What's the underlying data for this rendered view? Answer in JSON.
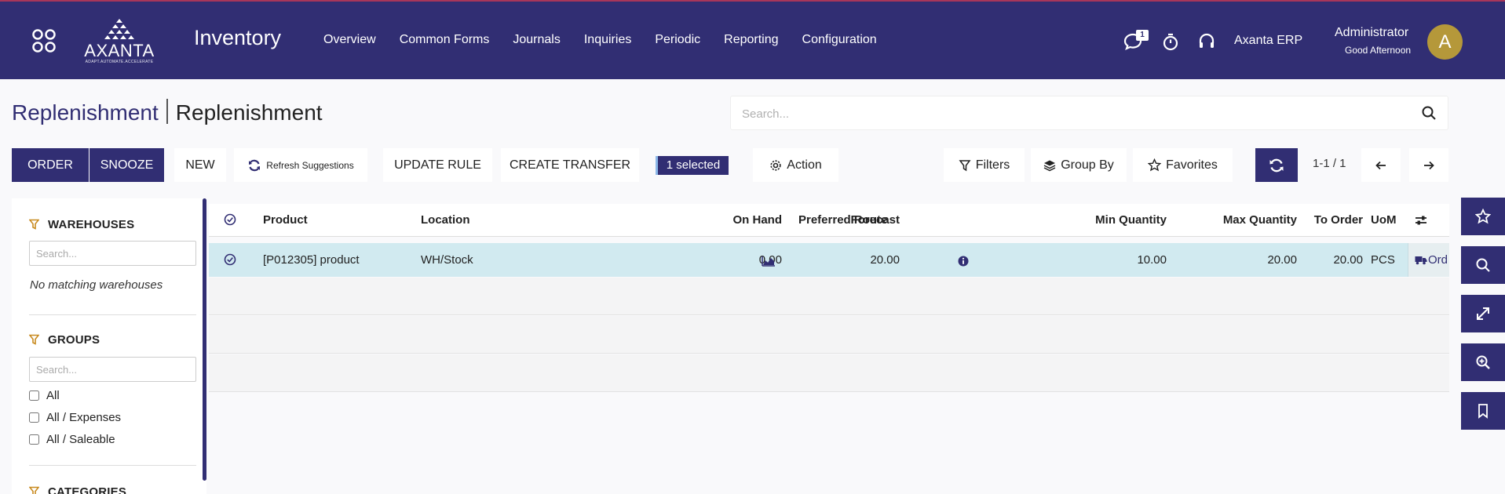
{
  "app": {
    "logo_text": "AXANTA",
    "logo_tagline": "ADAPT.AUTOMATE.ACCELERATE",
    "title": "Inventory",
    "nav": [
      "Overview",
      "Common Forms",
      "Journals",
      "Inquiries",
      "Periodic",
      "Reporting",
      "Configuration"
    ],
    "messages_badge": "1",
    "company": "Axanta ERP",
    "user_name": "Administrator",
    "user_greeting": "Good Afternoon",
    "avatar_letter": "A",
    "brand_color": "#312e73"
  },
  "breadcrumb": {
    "parent": "Replenishment",
    "current": "Replenishment"
  },
  "search": {
    "placeholder": "Search..."
  },
  "toolbar": {
    "order": "ORDER",
    "snooze": "SNOOZE",
    "new": "NEW",
    "refresh": "Refresh Suggestions",
    "update_rule": "UPDATE RULE",
    "create_transfer": "CREATE TRANSFER",
    "selected": "1 selected",
    "action": "Action",
    "filters": "Filters",
    "group_by": "Group By",
    "favorites": "Favorites",
    "pager": "1-1 / 1"
  },
  "sidebar": {
    "warehouses": {
      "title": "WAREHOUSES",
      "placeholder": "Search...",
      "empty": "No matching warehouses"
    },
    "groups": {
      "title": "GROUPS",
      "placeholder": "Search...",
      "items": [
        "All",
        "All / Expenses",
        "All / Saleable"
      ]
    },
    "categories": {
      "title": "CATEGORIES"
    }
  },
  "table": {
    "columns": [
      "Product",
      "Location",
      "On Hand",
      "Forecast",
      "Preferred Route",
      "Min Quantity",
      "Max Quantity",
      "To Order",
      "UoM"
    ],
    "rows": [
      {
        "product": "[P012305] product",
        "location": "WH/Stock",
        "on_hand": "0.00",
        "forecast": "20.00",
        "preferred_route": "",
        "min_qty": "10.00",
        "max_qty": "20.00",
        "to_order": "20.00",
        "uom": "PCS",
        "order_link": "Ord"
      }
    ]
  }
}
